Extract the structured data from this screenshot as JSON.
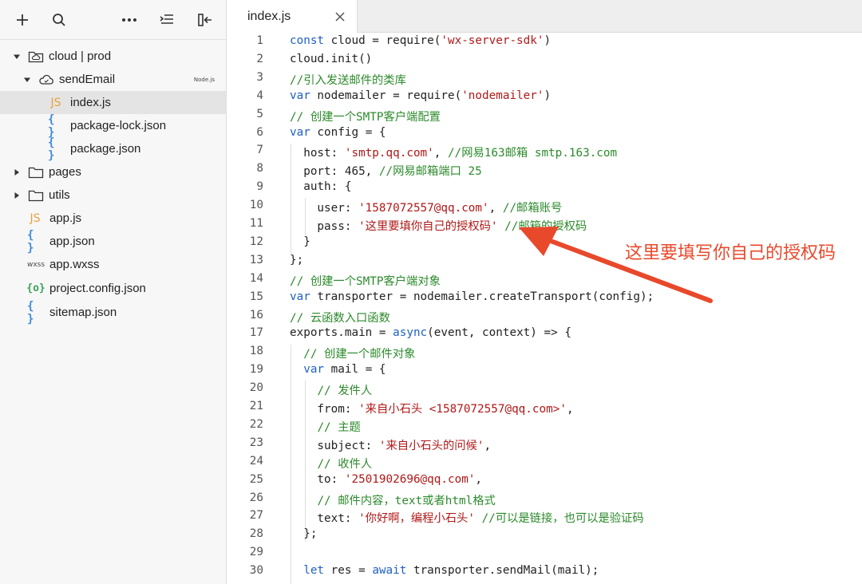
{
  "toolbar": {
    "icons": [
      "plus-icon",
      "search-icon",
      "more-icon",
      "outdent-icon",
      "collapse-panel-icon"
    ]
  },
  "explorer": {
    "items": [
      {
        "label": "cloud | prod",
        "type": "folder",
        "icon": "cloud-folder-icon",
        "expanded": true
      },
      {
        "label": "sendEmail",
        "type": "folder",
        "icon": "cloud-function-icon",
        "expanded": true,
        "badge": "Node.js"
      },
      {
        "label": "index.js",
        "type": "file",
        "icon_text": "JS",
        "selected": true
      },
      {
        "label": "package-lock.json",
        "type": "file",
        "icon_text": "{ }"
      },
      {
        "label": "package.json",
        "type": "file",
        "icon_text": "{ }"
      },
      {
        "label": "pages",
        "type": "folder",
        "expanded": false
      },
      {
        "label": "utils",
        "type": "folder",
        "expanded": false
      },
      {
        "label": "app.js",
        "type": "file",
        "icon_text": "JS"
      },
      {
        "label": "app.json",
        "type": "file",
        "icon_text": "{ }"
      },
      {
        "label": "app.wxss",
        "type": "file",
        "icon_text": "wxss"
      },
      {
        "label": "project.config.json",
        "type": "file",
        "icon_text": "{o}"
      },
      {
        "label": "sitemap.json",
        "type": "file",
        "icon_text": "{ }"
      }
    ]
  },
  "editor": {
    "tab_label": "index.js",
    "lines": [
      {
        "n": "1",
        "segs": [
          {
            "t": "const",
            "c": "kw"
          },
          {
            "t": " cloud = require("
          },
          {
            "t": "'wx-server-sdk'",
            "c": "str"
          },
          {
            "t": ")"
          }
        ]
      },
      {
        "n": "2",
        "segs": [
          {
            "t": "cloud.init()"
          }
        ]
      },
      {
        "n": "3",
        "segs": [
          {
            "t": "//引入发送邮件的类库",
            "c": "cm"
          }
        ]
      },
      {
        "n": "4",
        "segs": [
          {
            "t": "var",
            "c": "kw"
          },
          {
            "t": " nodemailer = require("
          },
          {
            "t": "'nodemailer'",
            "c": "str"
          },
          {
            "t": ")"
          }
        ]
      },
      {
        "n": "5",
        "segs": [
          {
            "t": "// 创建一个SMTP客户端配置",
            "c": "cm"
          }
        ]
      },
      {
        "n": "6",
        "segs": [
          {
            "t": "var",
            "c": "kw"
          },
          {
            "t": " config = {"
          }
        ]
      },
      {
        "n": "7",
        "segs": [
          {
            "t": "  host: "
          },
          {
            "t": "'smtp.qq.com'",
            "c": "str"
          },
          {
            "t": ", "
          },
          {
            "t": "//网易163邮箱 smtp.163.com",
            "c": "cm"
          }
        ]
      },
      {
        "n": "8",
        "segs": [
          {
            "t": "  port: 465, "
          },
          {
            "t": "//网易邮箱端口 25",
            "c": "cm"
          }
        ]
      },
      {
        "n": "9",
        "segs": [
          {
            "t": "  auth: {"
          }
        ]
      },
      {
        "n": "10",
        "segs": [
          {
            "t": "    user: "
          },
          {
            "t": "'1587072557@qq.com'",
            "c": "str"
          },
          {
            "t": ", "
          },
          {
            "t": "//邮箱账号",
            "c": "cm"
          }
        ]
      },
      {
        "n": "11",
        "segs": [
          {
            "t": "    pass: "
          },
          {
            "t": "'这里要填你自己的授权码'",
            "c": "str"
          },
          {
            "t": " "
          },
          {
            "t": "//邮箱的授权码",
            "c": "cm"
          }
        ]
      },
      {
        "n": "12",
        "segs": [
          {
            "t": "  }"
          }
        ]
      },
      {
        "n": "13",
        "segs": [
          {
            "t": "};"
          }
        ]
      },
      {
        "n": "14",
        "segs": [
          {
            "t": "// 创建一个SMTP客户端对象",
            "c": "cm"
          }
        ]
      },
      {
        "n": "15",
        "segs": [
          {
            "t": "var",
            "c": "kw"
          },
          {
            "t": " transporter = nodemailer.createTransport(config);"
          }
        ]
      },
      {
        "n": "16",
        "segs": [
          {
            "t": "// 云函数入口函数",
            "c": "cm"
          }
        ]
      },
      {
        "n": "17",
        "segs": [
          {
            "t": "exports.main = "
          },
          {
            "t": "async",
            "c": "kw"
          },
          {
            "t": "(event, context) => {"
          }
        ]
      },
      {
        "n": "18",
        "segs": [
          {
            "t": "  "
          },
          {
            "t": "// 创建一个邮件对象",
            "c": "cm"
          }
        ]
      },
      {
        "n": "19",
        "segs": [
          {
            "t": "  "
          },
          {
            "t": "var",
            "c": "kw"
          },
          {
            "t": " mail = {"
          }
        ]
      },
      {
        "n": "20",
        "segs": [
          {
            "t": "    "
          },
          {
            "t": "// 发件人",
            "c": "cm"
          }
        ]
      },
      {
        "n": "21",
        "segs": [
          {
            "t": "    from: "
          },
          {
            "t": "'来自小石头 <1587072557@qq.com>'",
            "c": "str"
          },
          {
            "t": ","
          }
        ]
      },
      {
        "n": "22",
        "segs": [
          {
            "t": "    "
          },
          {
            "t": "// 主题",
            "c": "cm"
          }
        ]
      },
      {
        "n": "23",
        "segs": [
          {
            "t": "    subject: "
          },
          {
            "t": "'来自小石头的问候'",
            "c": "str"
          },
          {
            "t": ","
          }
        ]
      },
      {
        "n": "24",
        "segs": [
          {
            "t": "    "
          },
          {
            "t": "// 收件人",
            "c": "cm"
          }
        ]
      },
      {
        "n": "25",
        "segs": [
          {
            "t": "    to: "
          },
          {
            "t": "'2501902696@qq.com'",
            "c": "str"
          },
          {
            "t": ","
          }
        ]
      },
      {
        "n": "26",
        "segs": [
          {
            "t": "    "
          },
          {
            "t": "// 邮件内容，text或者html格式",
            "c": "cm"
          }
        ]
      },
      {
        "n": "27",
        "segs": [
          {
            "t": "    text: "
          },
          {
            "t": "'你好啊，编程小石头'",
            "c": "str"
          },
          {
            "t": " "
          },
          {
            "t": "//可以是链接，也可以是验证码",
            "c": "cm"
          }
        ]
      },
      {
        "n": "28",
        "segs": [
          {
            "t": "  };"
          }
        ]
      },
      {
        "n": "29",
        "segs": []
      },
      {
        "n": "30",
        "segs": [
          {
            "t": "  "
          },
          {
            "t": "let",
            "c": "kw"
          },
          {
            "t": " res = "
          },
          {
            "t": "await",
            "c": "kw"
          },
          {
            "t": " transporter.sendMail(mail);"
          }
        ]
      }
    ]
  },
  "annotation": {
    "text": "这里要填写你自己的授权码",
    "color": "#e8492b"
  },
  "colors": {
    "keyword": "#1f5fc4",
    "string": "#b11818",
    "comment": "#2c8a2c"
  }
}
